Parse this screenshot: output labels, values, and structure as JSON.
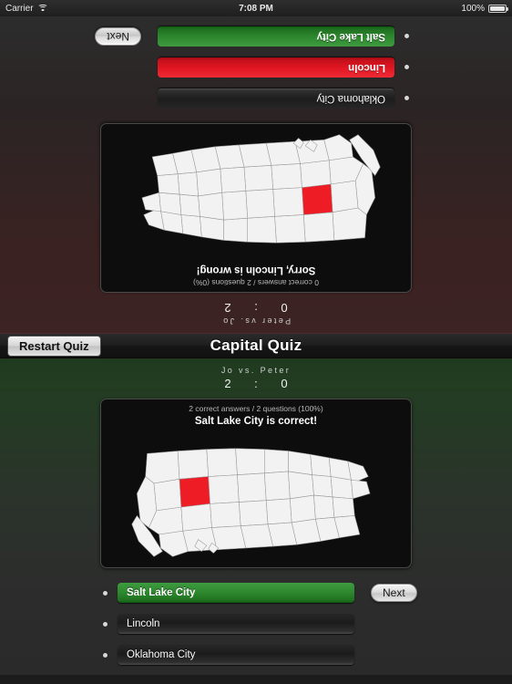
{
  "status_bar": {
    "carrier": "Carrier",
    "wifi_icon": "wifi-icon",
    "time": "7:08 PM",
    "battery_percent": "100%",
    "battery_icon": "battery-full-icon"
  },
  "nav": {
    "restart_label": "Restart Quiz",
    "title": "Capital Quiz"
  },
  "colors": {
    "correct": "#2f8a2f",
    "wrong": "#e31723",
    "highlight_state": "#ee1c25",
    "map_land": "#f2f2f2",
    "panel_bg": "#0d0d0d"
  },
  "player_top": {
    "names": "Peter  vs.  Jo",
    "score": "0 : 2",
    "stats": "0 correct answers / 2 questions (0%)",
    "feedback": "Sorry, Lincoln is wrong!",
    "feedback_type": "wrong",
    "highlighted_state": "Utah",
    "answers": [
      {
        "label": "Salt Lake City",
        "state": "neutral"
      },
      {
        "label": "Lincoln",
        "state": "wrong"
      },
      {
        "label": "Oklahoma City",
        "state": "neutral"
      }
    ],
    "next_label": "Next"
  },
  "player_bottom": {
    "names": "Jo  vs.  Peter",
    "score": "2 : 0",
    "stats": "2 correct answers / 2 questions (100%)",
    "feedback": "Salt Lake City is correct!",
    "feedback_type": "correct",
    "highlighted_state": "Utah",
    "answers": [
      {
        "label": "Salt Lake City",
        "state": "correct"
      },
      {
        "label": "Lincoln",
        "state": "neutral"
      },
      {
        "label": "Oklahoma City",
        "state": "neutral"
      }
    ],
    "next_label": "Next"
  }
}
